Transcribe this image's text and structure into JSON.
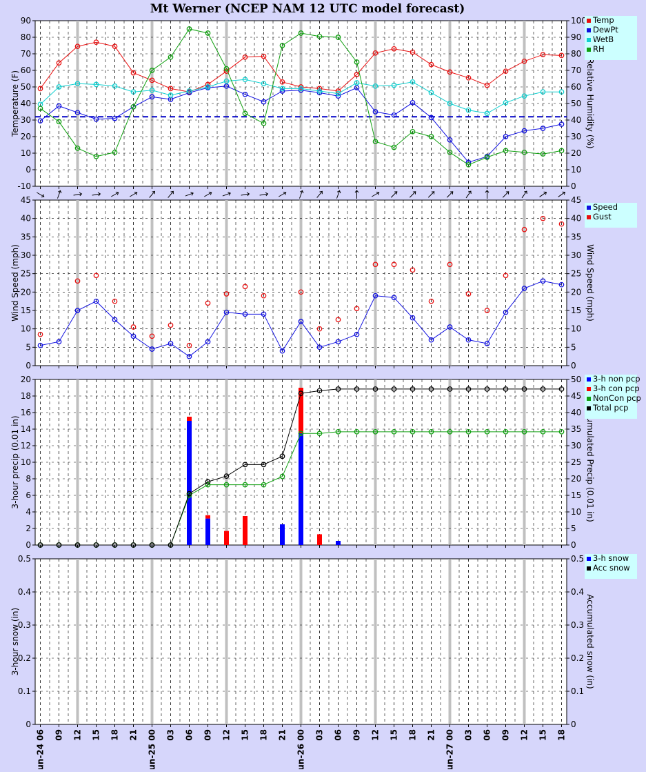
{
  "title": "Mt Werner (NCEP NAM 12 UTC model forecast)",
  "colors": {
    "background": "#d6d6fb",
    "plot_bg": "#ffffff",
    "temp": "#e81010",
    "dewpt": "#1010e0",
    "wetb": "#10d0d0",
    "rh": "#10a010",
    "freezing_line": "#0000c8",
    "gust": "#e81010",
    "speed": "#1010e0",
    "non_pcp": "#0000ff",
    "con_pcp": "#ff0000",
    "noncon_acc": "#10a010",
    "total_acc": "#000000",
    "legend_bg": "#ccffff"
  },
  "x_axis": {
    "tick_labels": [
      "Jun-24 06",
      "09",
      "12",
      "15",
      "18",
      "21",
      "Jun-25 00",
      "03",
      "06",
      "09",
      "12",
      "15",
      "18",
      "21",
      "Jun-26 00",
      "03",
      "06",
      "09",
      "12",
      "15",
      "18",
      "21",
      "Jun-27 00",
      "03",
      "06",
      "09",
      "12",
      "15",
      "18"
    ],
    "day_boundaries": [
      6,
      14,
      22
    ],
    "major_every": 4
  },
  "chart_data": [
    {
      "type": "line",
      "name": "temperature-panel",
      "ylabel": "Temperature (F)",
      "y2label": "Relative Humidity (%)",
      "ylim": [
        -10,
        90
      ],
      "y_ticks": [
        -10,
        0,
        10,
        20,
        30,
        40,
        50,
        60,
        70,
        80,
        90
      ],
      "y2lim": [
        0,
        100
      ],
      "y2_ticks": [
        0,
        10,
        20,
        30,
        40,
        50,
        60,
        70,
        80,
        90,
        100
      ],
      "reference_line": 32,
      "legend": [
        "Temp",
        "DewPt",
        "WetB",
        "RH"
      ],
      "series": [
        {
          "name": "Temp",
          "axis": "left",
          "values": [
            49,
            64.5,
            74.5,
            77,
            74.5,
            58.5,
            54,
            49,
            47,
            51.5,
            59.5,
            68,
            68.5,
            53,
            50,
            49,
            47.5,
            57.5,
            70.5,
            73,
            71,
            63.5,
            59,
            55.5,
            51,
            59.5,
            65.5,
            69.5,
            69
          ]
        },
        {
          "name": "DewPt",
          "axis": "left",
          "values": [
            29.5,
            38.5,
            34.5,
            30.5,
            31,
            38,
            44,
            42.5,
            46.5,
            49.5,
            50.5,
            45.5,
            41,
            47.5,
            48,
            46.5,
            44.5,
            49.5,
            35,
            33,
            40.5,
            31.5,
            18,
            4.5,
            8,
            20,
            23.5,
            25,
            27.5
          ]
        },
        {
          "name": "WetB",
          "axis": "left",
          "values": [
            39.5,
            50,
            52,
            51.5,
            50.5,
            47,
            48,
            45,
            47.5,
            50,
            53.5,
            54.5,
            52,
            49,
            49,
            47.5,
            46,
            52.5,
            50.5,
            51,
            53,
            46.5,
            40,
            36,
            34,
            40.5,
            44.5,
            47,
            47
          ]
        },
        {
          "name": "RH",
          "axis": "right",
          "values": [
            47,
            39,
            23,
            18,
            20.5,
            48,
            70,
            78,
            95,
            92.5,
            71,
            44,
            38,
            85,
            92.5,
            90.5,
            90,
            75,
            27,
            23.5,
            33,
            30,
            20.5,
            13,
            17.5,
            21.5,
            20.5,
            19.5,
            21.5
          ]
        }
      ]
    },
    {
      "type": "scatter",
      "name": "wind-panel",
      "ylabel": "Wind Speed (mph)",
      "y2label": "Wind Speed (mph)",
      "ylim": [
        0,
        45
      ],
      "y_ticks": [
        0,
        5,
        10,
        15,
        20,
        25,
        30,
        35,
        40,
        45
      ],
      "legend": [
        "Speed",
        "Gust"
      ],
      "wind_direction_deg": [
        300,
        200,
        260,
        260,
        240,
        240,
        220,
        220,
        250,
        240,
        250,
        260,
        260,
        240,
        200,
        220,
        200,
        180,
        240,
        225,
        225,
        225,
        225,
        215,
        180,
        225,
        215,
        235,
        235
      ],
      "series": [
        {
          "name": "Speed",
          "values": [
            5.5,
            6.5,
            15,
            17.5,
            12.5,
            8,
            4.5,
            6,
            2.5,
            6.5,
            14.5,
            14,
            14,
            4,
            12,
            5,
            6.5,
            8.5,
            19,
            18.5,
            13,
            7,
            10.5,
            7,
            6,
            14.5,
            21,
            23,
            22
          ]
        },
        {
          "name": "Gust",
          "values": [
            8.5,
            null,
            23,
            24.5,
            17.5,
            10.5,
            8,
            11,
            5.5,
            17,
            19.5,
            21.5,
            19,
            null,
            20,
            10,
            12.5,
            15.5,
            27.5,
            27.5,
            26,
            17.5,
            27.5,
            19.5,
            15,
            24.5,
            37,
            40,
            38.5
          ]
        }
      ]
    },
    {
      "type": "bar",
      "name": "precip-panel",
      "ylabel": "3-hour precip (0.01 in)",
      "y2label": "Accumulated Precip (0.01 in)",
      "ylim": [
        0,
        20
      ],
      "y_ticks": [
        0,
        2,
        4,
        6,
        8,
        10,
        12,
        14,
        16,
        18,
        20
      ],
      "y2lim": [
        0,
        50
      ],
      "y2_ticks": [
        0,
        5,
        10,
        15,
        20,
        25,
        30,
        35,
        40,
        45,
        50
      ],
      "legend": [
        "3-h non pcp",
        "3-h con pcp",
        "NonCon pcp",
        "Total pcp"
      ],
      "series": [
        {
          "name": "3-h non pcp",
          "values": [
            0,
            0,
            0,
            0,
            0,
            0,
            0,
            0,
            15,
            3.2,
            0,
            0,
            0,
            2.5,
            13.5,
            0,
            0.5,
            0,
            0,
            0,
            0,
            0,
            0,
            0,
            0,
            0,
            0,
            0,
            0
          ]
        },
        {
          "name": "3-h con pcp",
          "values": [
            0,
            0,
            0,
            0,
            0,
            0,
            0,
            0,
            0.5,
            0.4,
            1.7,
            3.5,
            0,
            0,
            5.5,
            1.3,
            0,
            0,
            0,
            0,
            0,
            0,
            0,
            0,
            0,
            0,
            0,
            0,
            0
          ]
        },
        {
          "name": "NonCon pcp",
          "axis": "right",
          "values": [
            0,
            0,
            0,
            0,
            0,
            0,
            0,
            0,
            15,
            18.2,
            18.2,
            18.2,
            18.2,
            20.7,
            33.7,
            33.7,
            34.2,
            34.2,
            34.2,
            34.2,
            34.2,
            34.2,
            34.2,
            34.2,
            34.2,
            34.2,
            34.2,
            34.2,
            34.2
          ]
        },
        {
          "name": "Total pcp",
          "axis": "right",
          "values": [
            0,
            0,
            0,
            0,
            0,
            0,
            0,
            0,
            15.5,
            19.1,
            20.8,
            24.3,
            24.3,
            26.8,
            45.8,
            46.6,
            47.1,
            47.1,
            47.1,
            47.1,
            47.1,
            47.1,
            47.1,
            47.1,
            47.1,
            47.1,
            47.1,
            47.1,
            47.1
          ]
        }
      ]
    },
    {
      "type": "line",
      "name": "snow-panel",
      "ylabel": "3-hour snow (in)",
      "y2label": "Accumulated snow (in)",
      "ylim": [
        0,
        0.5
      ],
      "y_ticks": [
        "0",
        "0.1",
        "0.2",
        "0.3",
        "0.4",
        "0.5"
      ],
      "legend": [
        "3-h snow",
        "Acc snow"
      ],
      "series": []
    }
  ]
}
